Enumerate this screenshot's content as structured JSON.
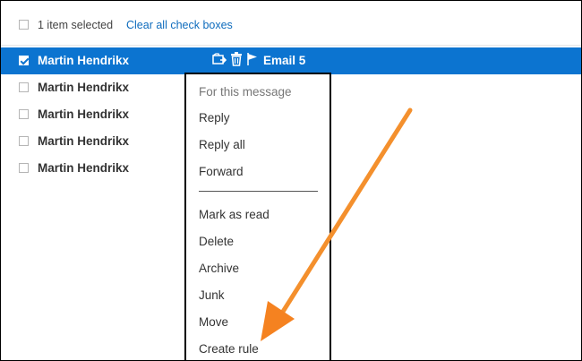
{
  "toolbar": {
    "selected_count": "1 item selected",
    "clear_link": "Clear all check boxes"
  },
  "messages": [
    {
      "sender": "Martin Hendrikx",
      "subject": "Email 5",
      "selected": true,
      "checked": true
    },
    {
      "sender": "Martin Hendrikx",
      "selected": false,
      "checked": false
    },
    {
      "sender": "Martin Hendrikx",
      "selected": false,
      "checked": false
    },
    {
      "sender": "Martin Hendrikx",
      "selected": false,
      "checked": false
    },
    {
      "sender": "Martin Hendrikx",
      "selected": false,
      "checked": false
    }
  ],
  "row_icons": [
    "move-to-folder-icon",
    "trash-icon",
    "flag-icon"
  ],
  "context_menu": {
    "header": "For this message",
    "group1": [
      "Reply",
      "Reply all",
      "Forward"
    ],
    "group2": [
      "Mark as read",
      "Delete",
      "Archive",
      "Junk",
      "Move",
      "Create rule"
    ]
  },
  "colors": {
    "selection": "#0c74d0",
    "link": "#0f6cbd",
    "annotation_arrow": "#f58220"
  }
}
